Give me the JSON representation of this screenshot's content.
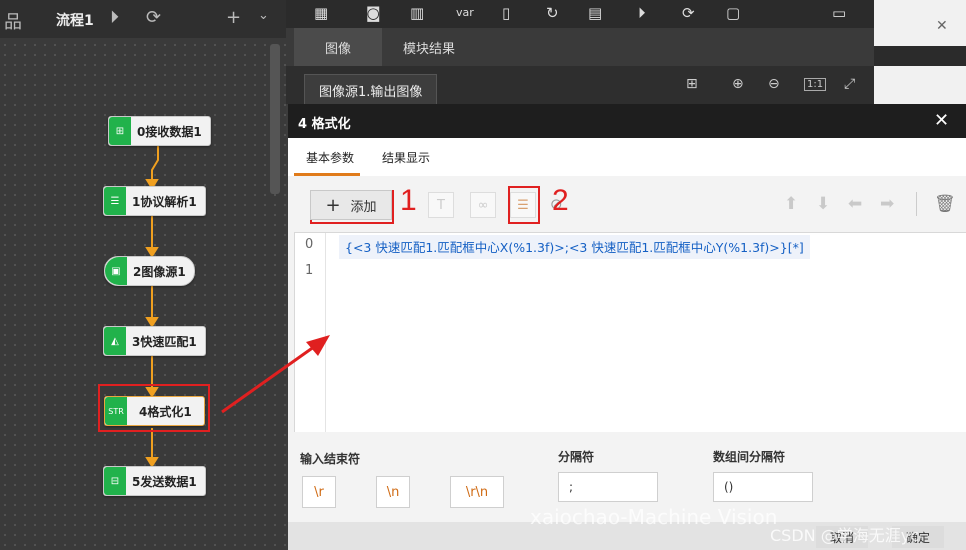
{
  "flow": {
    "title": "流程1",
    "nodes": [
      {
        "label": "0接收数据1",
        "icon": "receive-data-icon"
      },
      {
        "label": "1协议解析1",
        "icon": "protocol-parse-icon"
      },
      {
        "label": "2图像源1",
        "icon": "image-source-icon"
      },
      {
        "label": "3快速匹配1",
        "icon": "fast-match-icon"
      },
      {
        "label": "4格式化1",
        "icon": "format-icon",
        "icon_text": "STR"
      },
      {
        "label": "5发送数据1",
        "icon": "send-data-icon"
      }
    ]
  },
  "image_tabs": [
    "图像",
    "模块结果"
  ],
  "image_source": "图像源1.输出图像",
  "toolbar_var_label": "var",
  "dialog": {
    "title": "4 格式化",
    "close": "✕",
    "tabs": [
      "基本参数",
      "结果显示"
    ],
    "add_label": "添加",
    "annotations": [
      "1",
      "2"
    ],
    "lines": [
      "0",
      "1"
    ],
    "code": "{<3 快速匹配1.匹配框中心X(%1.3f)>;<3 快速匹配1.匹配框中心Y(%1.3f)>}[*]",
    "input_end_label": "输入结束符",
    "end_chars": [
      "\\r",
      "\\n",
      "\\r\\n"
    ],
    "separator_label": "分隔符",
    "separator_value": ";",
    "array_separator_label": "数组间分隔符",
    "array_separator_value": "()",
    "cancel": "取消",
    "confirm": "确定"
  },
  "watermark": "xaiochao-Machine Vision",
  "watermark2": "CSDN @学海无涯yc",
  "colors": {
    "node_green": "#21b24b",
    "accent": "#e07b1a",
    "annotation_red": "#e02020",
    "code_blue": "#1560c4"
  }
}
